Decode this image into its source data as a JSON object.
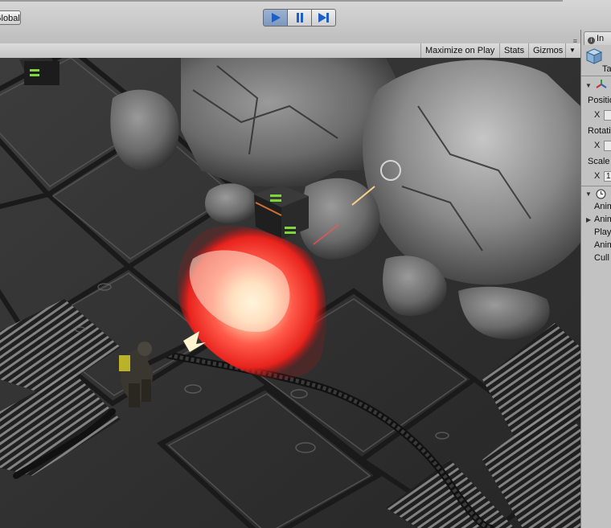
{
  "toolbar": {
    "pivot_rotation_label": "Global",
    "play_controls": [
      {
        "name": "play",
        "icon": "play-icon",
        "active": true
      },
      {
        "name": "pause",
        "icon": "pause-icon",
        "active": false
      },
      {
        "name": "step",
        "icon": "step-icon",
        "active": false
      }
    ]
  },
  "game_view": {
    "maximize_on_play": "Maximize on Play",
    "stats": "Stats",
    "gizmos": "Gizmos",
    "gizmos_dropdown_icon": "chevron-down-icon"
  },
  "inspector": {
    "tab_label": "Inspector",
    "tab_label_visible": "In",
    "tag_label": "Ta",
    "transform": {
      "position_label": "Positio",
      "position_x_label": "X",
      "rotation_label": "Rotati",
      "rotation_x_label": "X",
      "scale_label": "Scale",
      "scale_x_label": "X",
      "scale_x_value": "1"
    },
    "animation_component": {
      "rows": [
        "Anim",
        "Anim",
        "Play",
        "Anim",
        "Cull"
      ]
    }
  },
  "colors": {
    "toolbar_bg": "#c8c8c8",
    "play_active": "#8aa3c8",
    "play_icon": "#1d5fc4",
    "explosion": "#ff3b30"
  }
}
